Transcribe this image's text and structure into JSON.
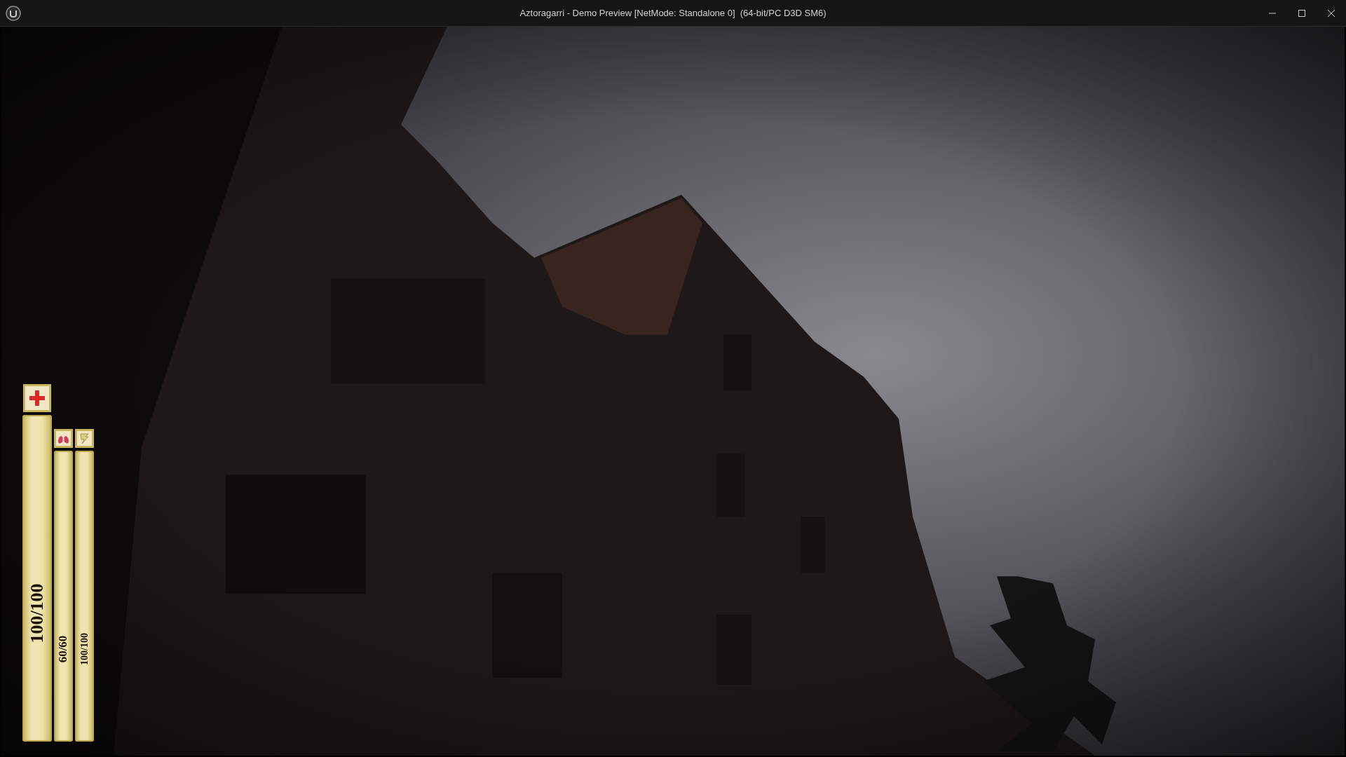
{
  "window": {
    "title": "Aztoragarri - Demo Preview [NetMode: Standalone 0]  (64-bit/PC D3D SM6)"
  },
  "hud": {
    "bars": [
      {
        "kind": "health",
        "level": 1,
        "reading": "100/100"
      },
      {
        "kind": "breath",
        "level": 1,
        "reading": "60/60"
      },
      {
        "kind": "stamina",
        "level": 1,
        "reading": "100/100"
      }
    ]
  }
}
